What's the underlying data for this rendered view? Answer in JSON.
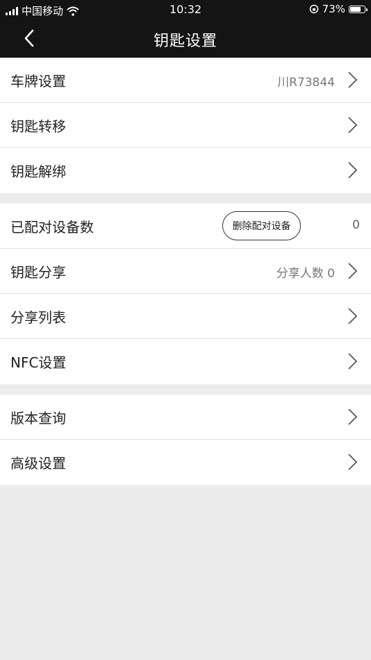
{
  "status_bar": {
    "carrier": "中国移动",
    "time": "10:32",
    "battery": "73%",
    "battery_level": 0.73
  },
  "nav": {
    "title": "钥匙设置"
  },
  "group1": [
    {
      "label": "车牌设置",
      "value": "川R73844"
    },
    {
      "label": "钥匙转移",
      "value": ""
    },
    {
      "label": "钥匙解绑",
      "value": ""
    }
  ],
  "group2": {
    "paired": {
      "label": "已配对设备数",
      "button": "删除配对设备",
      "count": "0"
    },
    "share": {
      "label": "钥匙分享",
      "value": "分享人数 0"
    },
    "share_list": {
      "label": "分享列表"
    },
    "nfc": {
      "label": "NFC设置"
    }
  },
  "group3": [
    {
      "label": "版本查询"
    },
    {
      "label": "高级设置"
    }
  ]
}
